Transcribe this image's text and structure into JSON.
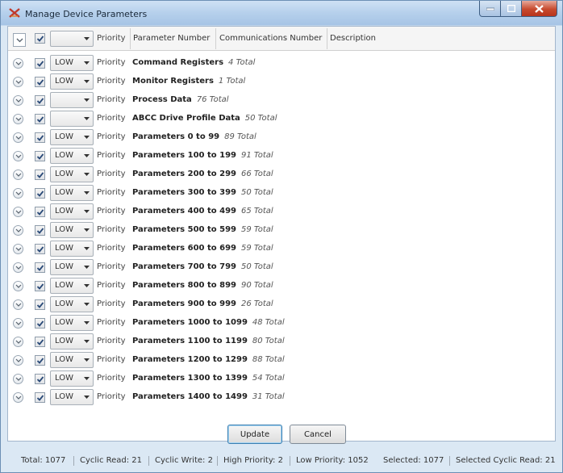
{
  "window": {
    "title": "Manage Device Parameters"
  },
  "header": {
    "combo_value": "",
    "priority_label": "Priority",
    "columns": [
      "Parameter Number",
      "Communications Number",
      "Description"
    ]
  },
  "rows": [
    {
      "priority": "LOW",
      "label": "Priority",
      "name": "Command Registers",
      "total": "4 Total"
    },
    {
      "priority": "LOW",
      "label": "Priority",
      "name": "Monitor Registers",
      "total": "1 Total"
    },
    {
      "priority": "",
      "label": "Priority",
      "name": "Process Data",
      "total": "76 Total"
    },
    {
      "priority": "",
      "label": "Priority",
      "name": "ABCC Drive Profile Data",
      "total": "50 Total"
    },
    {
      "priority": "LOW",
      "label": "Priority",
      "name": "Parameters 0 to 99",
      "total": "89 Total"
    },
    {
      "priority": "LOW",
      "label": "Priority",
      "name": "Parameters 100 to 199",
      "total": "91 Total"
    },
    {
      "priority": "LOW",
      "label": "Priority",
      "name": "Parameters 200 to 299",
      "total": "66 Total"
    },
    {
      "priority": "LOW",
      "label": "Priority",
      "name": "Parameters 300 to 399",
      "total": "50 Total"
    },
    {
      "priority": "LOW",
      "label": "Priority",
      "name": "Parameters 400 to 499",
      "total": "65 Total"
    },
    {
      "priority": "LOW",
      "label": "Priority",
      "name": "Parameters 500 to 599",
      "total": "59 Total"
    },
    {
      "priority": "LOW",
      "label": "Priority",
      "name": "Parameters 600 to 699",
      "total": "59 Total"
    },
    {
      "priority": "LOW",
      "label": "Priority",
      "name": "Parameters 700 to 799",
      "total": "50 Total"
    },
    {
      "priority": "LOW",
      "label": "Priority",
      "name": "Parameters 800 to 899",
      "total": "90 Total"
    },
    {
      "priority": "LOW",
      "label": "Priority",
      "name": "Parameters 900 to 999",
      "total": "26 Total"
    },
    {
      "priority": "LOW",
      "label": "Priority",
      "name": "Parameters 1000 to 1099",
      "total": "48 Total"
    },
    {
      "priority": "LOW",
      "label": "Priority",
      "name": "Parameters 1100 to 1199",
      "total": "80 Total"
    },
    {
      "priority": "LOW",
      "label": "Priority",
      "name": "Parameters 1200 to 1299",
      "total": "88 Total"
    },
    {
      "priority": "LOW",
      "label": "Priority",
      "name": "Parameters 1300 to 1399",
      "total": "54 Total"
    },
    {
      "priority": "LOW",
      "label": "Priority",
      "name": "Parameters 1400 to 1499",
      "total": "31 Total"
    }
  ],
  "buttons": {
    "update": "Update",
    "cancel": "Cancel"
  },
  "status": {
    "total": "Total: 1077",
    "cyclic_read": "Cyclic Read: 21",
    "cyclic_write": "Cyclic Write: 2",
    "high_priority": "High Priority: 2",
    "low_priority": "Low Priority: 1052",
    "selected": "Selected: 1077",
    "selected_cyclic_read": "Selected Cyclic Read: 21"
  },
  "icons": {
    "app": "app-logo-icon",
    "expander": "chevron-down-icon",
    "check": "checkmark-icon",
    "combo_arrow": "dropdown-arrow-icon"
  },
  "colors": {
    "titlebar": "#b6d0ec",
    "close_button": "#c74a2e",
    "check": "#2a4a78"
  }
}
